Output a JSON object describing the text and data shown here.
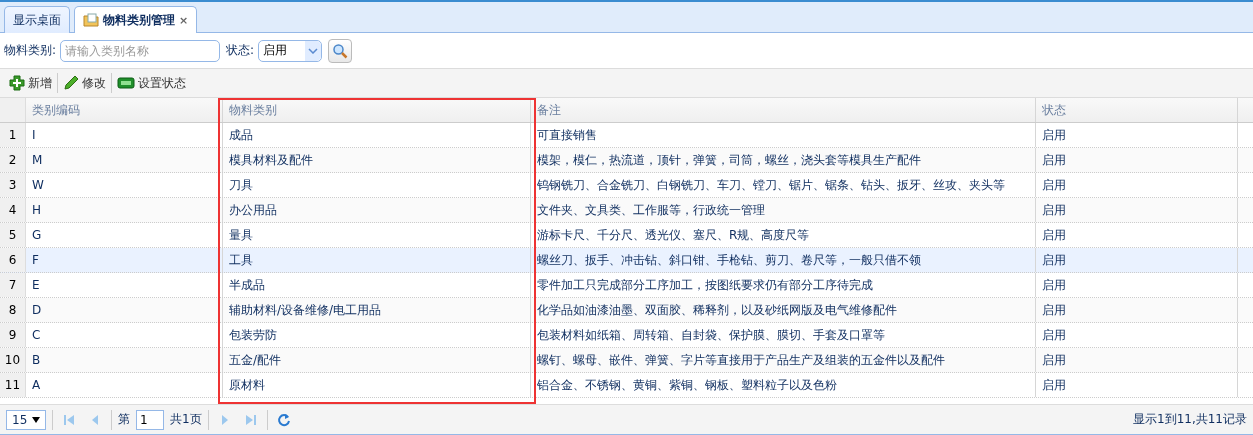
{
  "tabs": [
    {
      "label": "显示桌面",
      "selected": false,
      "closable": false,
      "icon": false
    },
    {
      "label": "物料类别管理",
      "selected": true,
      "closable": true,
      "icon": true
    }
  ],
  "close_glyph": "×",
  "search": {
    "label": "物料类别:",
    "placeholder": "请输入类别名称",
    "status_label": "状态:",
    "status_value": "启用"
  },
  "toolbar": [
    {
      "label": "新增",
      "kind": "add"
    },
    {
      "label": "修改",
      "kind": "edit"
    },
    {
      "label": "设置状态",
      "kind": "status"
    }
  ],
  "table": {
    "columns": [
      {
        "label": "类别编码",
        "highlighted": false
      },
      {
        "label": "物料类别",
        "highlighted": true
      },
      {
        "label": "备注",
        "highlighted": false
      },
      {
        "label": "状态",
        "highlighted": false
      }
    ],
    "rows": [
      {
        "num": "1",
        "cells": [
          "I",
          "成品",
          "可直接销售",
          "启用"
        ],
        "selected": false
      },
      {
        "num": "2",
        "cells": [
          "M",
          "模具材料及配件",
          "模架，模仁，热流道，顶针，弹簧，司筒，螺丝，浇头套等模具生产配件",
          "启用"
        ],
        "selected": false
      },
      {
        "num": "3",
        "cells": [
          "W",
          "刀具",
          "钨钢铣刀、合金铣刀、白钢铣刀、车刀、镗刀、锯片、锯条、钻头、扳牙、丝攻、夹头等",
          "启用"
        ],
        "selected": false
      },
      {
        "num": "4",
        "cells": [
          "H",
          "办公用品",
          "文件夹、文具类、工作服等，行政统一管理",
          "启用"
        ],
        "selected": false
      },
      {
        "num": "5",
        "cells": [
          "G",
          "量具",
          "游标卡尺、千分尺、透光仪、塞尺、R规、高度尺等",
          "启用"
        ],
        "selected": false
      },
      {
        "num": "6",
        "cells": [
          "F",
          "工具",
          "螺丝刀、扳手、冲击钻、斜口钳、手枪钻、剪刀、卷尺等，一般只借不领",
          "启用"
        ],
        "selected": true
      },
      {
        "num": "7",
        "cells": [
          "E",
          "半成品",
          "零件加工只完成部分工序加工，按图纸要求仍有部分工序待完成",
          "启用"
        ],
        "selected": false
      },
      {
        "num": "8",
        "cells": [
          "D",
          "辅助材料/设备维修/电工用品",
          "化学品如油漆油墨、双面胶、稀释剂，以及砂纸网版及电气维修配件",
          "启用"
        ],
        "selected": false
      },
      {
        "num": "9",
        "cells": [
          "C",
          "包装劳防",
          "包装材料如纸箱、周转箱、自封袋、保护膜、膜切、手套及口罩等",
          "启用"
        ],
        "selected": false
      },
      {
        "num": "10",
        "cells": [
          "B",
          "五金/配件",
          "螺钉、螺母、嵌件、弹簧、字片等直接用于产品生产及组装的五金件以及配件",
          "启用"
        ],
        "selected": false
      },
      {
        "num": "11",
        "cells": [
          "A",
          "原材料",
          "铝合金、不锈钢、黄铜、紫铜、钢板、塑料粒子以及色粉",
          "启用"
        ],
        "selected": false
      }
    ]
  },
  "pager": {
    "page_size": "15",
    "page_prefix": "第",
    "page": "1",
    "page_suffix": "共1页",
    "summary": "显示1到11,共11记录"
  }
}
